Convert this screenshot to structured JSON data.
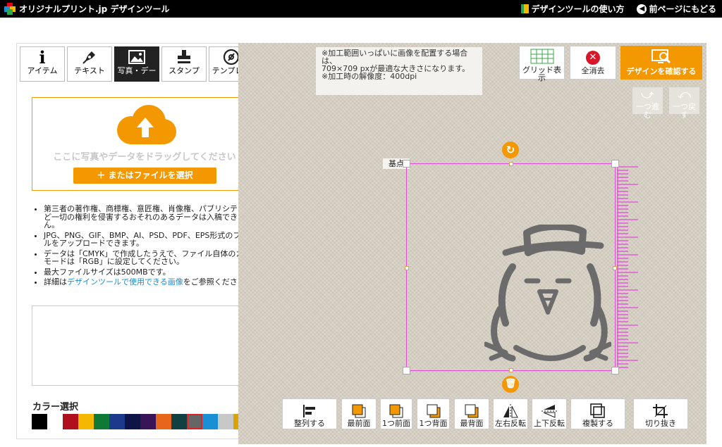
{
  "header": {
    "logo_text": "オリジナルプリント.jp デザインツール",
    "how_to": "デザインツールの使い方",
    "back": "前ページにもどる"
  },
  "tabs": [
    {
      "label": "アイテム",
      "icon": "info-i-icon"
    },
    {
      "label": "テキスト",
      "icon": "pen-icon"
    },
    {
      "label": "写真・デー",
      "icon": "image-icon",
      "active": true
    },
    {
      "label": "スタンプ",
      "icon": "stamp-icon"
    },
    {
      "label": "テンプレー",
      "icon": "template-disc-icon"
    }
  ],
  "upload": {
    "drop_text": "ここに写真やデータをドラッグしてください",
    "select_button": "＋ またはファイルを選択"
  },
  "notes": {
    "n1": "第三者の著作権、商標権、意匠権、肖像権、パブリシティ権など一切の権利を侵害するおそれのあるデータは入稿できません。",
    "n2": "JPG、PNG、GIF、BMP、AI、PSD、PDF、EPS形式のファイルをアップロードできます。",
    "n3": "データは「CMYK」で作成したうえで、ファイル自体のカラーモードは「RGB」に設定してください。",
    "n4": "最大ファイルサイズは500MBです。",
    "n5_pre": "詳細は",
    "n5_link": "デザインツールで使用できる画像",
    "n5_post": "をご参照ください。"
  },
  "color_select": {
    "title": "カラー選択",
    "swatches": [
      "#000000",
      "#ffffff",
      "#b0101e",
      "#f5b800",
      "#0f7a35",
      "#1b3a8c",
      "#0f1446",
      "#3a1458",
      "#e8661b",
      "#114040",
      "#666666",
      "#1b8fd4",
      "#c8c8c8",
      "#d9a300",
      "#f5a0c8"
    ],
    "selected_index": 10
  },
  "canvas": {
    "info_lines": "※加工範囲いっぱいに画像を配置する場合は、\n709×709 pxが最適な大きさになります。\n※加工時の解像度：400dpi",
    "grid_button": "グリッド表示",
    "clear_button": "全消去",
    "confirm_button": "デザインを確認する",
    "redo": "一つ進む",
    "undo": "一つ戻す",
    "origin_label": "基点"
  },
  "toolbar": [
    {
      "label": "整列する",
      "icon": "align-icon"
    },
    {
      "label": "最前面",
      "icon": "bring-front-icon"
    },
    {
      "label": "1つ前面",
      "icon": "forward-one-icon"
    },
    {
      "label": "1つ背面",
      "icon": "backward-one-icon"
    },
    {
      "label": "最背面",
      "icon": "send-back-icon"
    },
    {
      "label": "左右反転",
      "icon": "flip-horizontal-icon"
    },
    {
      "label": "上下反転",
      "icon": "flip-vertical-icon"
    },
    {
      "label": "複製する",
      "icon": "duplicate-icon"
    },
    {
      "label": "切り抜き",
      "icon": "crop-icon"
    }
  ],
  "colors": {
    "accent": "#f39800",
    "selection": "#e14bd8",
    "ruler": "#e14bd8"
  }
}
